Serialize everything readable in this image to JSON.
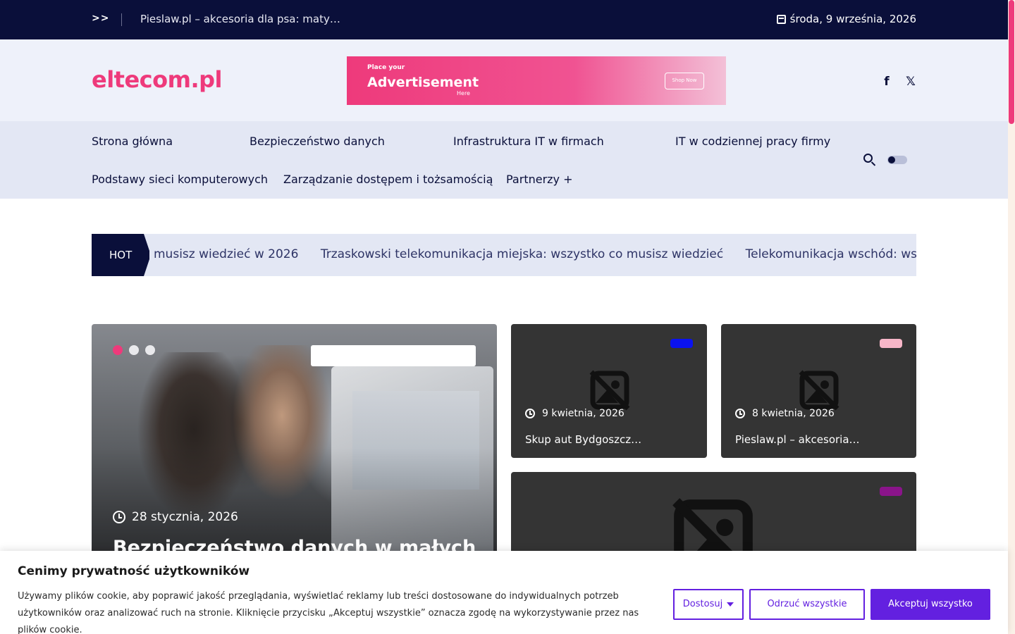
{
  "topbar": {
    "chevrons": ">>",
    "ticker": "Pieslaw.pl – akcesoria dla psa: maty…",
    "date": "środa, 9 września, 2026"
  },
  "header": {
    "logo": "eltecom.pl",
    "ad": {
      "small": "Place your",
      "big": "Advertisement",
      "here": "Here",
      "button": "Shop Now"
    },
    "social": [
      "facebook-icon",
      "x-icon"
    ]
  },
  "nav": {
    "items": [
      "Strona główna",
      "Bezpieczeństwo danych",
      "Infrastruktura IT w firmach",
      "IT w codziennej pracy firmy",
      "Podstawy sieci komputerowych",
      "Zarządzanie dostępem i tożsamością",
      "Partnerzy +"
    ]
  },
  "hot": {
    "label": "HOT",
    "items": [
      "musisz wiedzieć w 2026",
      "Trzaskowski telekomunikacja miejska: wszystko co musisz wiedzieć",
      "Telekomunikacja wschód: wszyst"
    ]
  },
  "feature": {
    "date": "28 stycznia, 2026",
    "title": "Bezpieczeństwo danych w małych"
  },
  "cards": [
    {
      "date": "9 kwietnia, 2026",
      "title": "Skup aut Bydgoszcz…",
      "pill_color": "#0a12f0"
    },
    {
      "date": "8 kwietnia, 2026",
      "title": "Pieslaw.pl – akcesoria…",
      "pill_color": "#f7b6c8"
    },
    {
      "date": "",
      "title": "",
      "pill_color": "#8a148a"
    }
  ],
  "cookie": {
    "title": "Cenimy prywatność użytkowników",
    "text": "Używamy plików cookie, aby poprawić jakość przeglądania, wyświetlać reklamy lub treści dostosowane do indywidualnych potrzeb użytkowników oraz analizować ruch na stronie. Kliknięcie przycisku „Akceptuj wszystkie” oznacza zgodę na wykorzystywanie przez nas plików cookie.",
    "customize": "Dostosuj",
    "reject": "Odrzuć wszystkie",
    "accept": "Akceptuj wszystko"
  },
  "colors": {
    "navy": "#0a0f3a",
    "accent": "#ee3a7b",
    "purple": "#6320e0"
  }
}
